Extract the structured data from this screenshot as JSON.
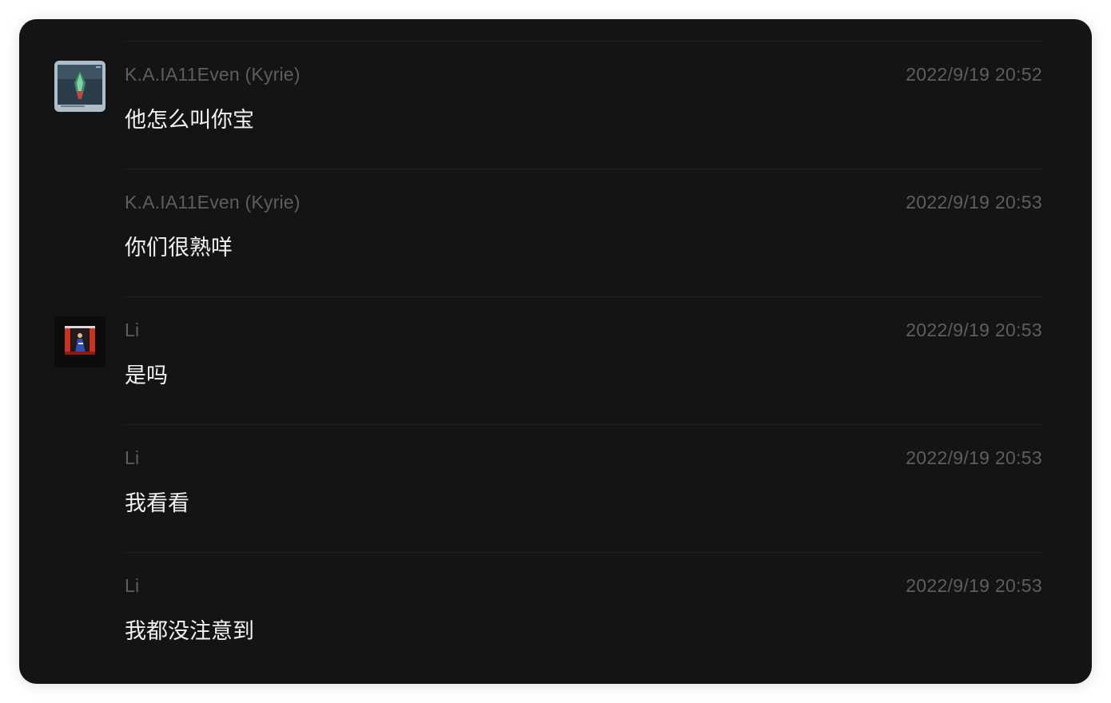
{
  "messages": [
    {
      "sender": "K.A.IA11Even (Kyrie)",
      "time": "2022/9/19 20:52",
      "text": "他怎么叫你宝",
      "show_avatar": true,
      "avatar": "kyrie-avatar"
    },
    {
      "sender": "K.A.IA11Even (Kyrie)",
      "time": "2022/9/19 20:53",
      "text": "你们很熟咩",
      "show_avatar": false
    },
    {
      "sender": "Li",
      "time": "2022/9/19 20:53",
      "text": "是吗",
      "show_avatar": true,
      "avatar": "li-avatar"
    },
    {
      "sender": "Li",
      "time": "2022/9/19 20:53",
      "text": "我看看",
      "show_avatar": false
    },
    {
      "sender": "Li",
      "time": "2022/9/19 20:53",
      "text": "我都没注意到",
      "show_avatar": false
    }
  ],
  "colors": {
    "background": "#141414",
    "sender_text": "#5e5e5e",
    "message_text": "#f2f2f2",
    "divider": "#1f1f1f"
  }
}
